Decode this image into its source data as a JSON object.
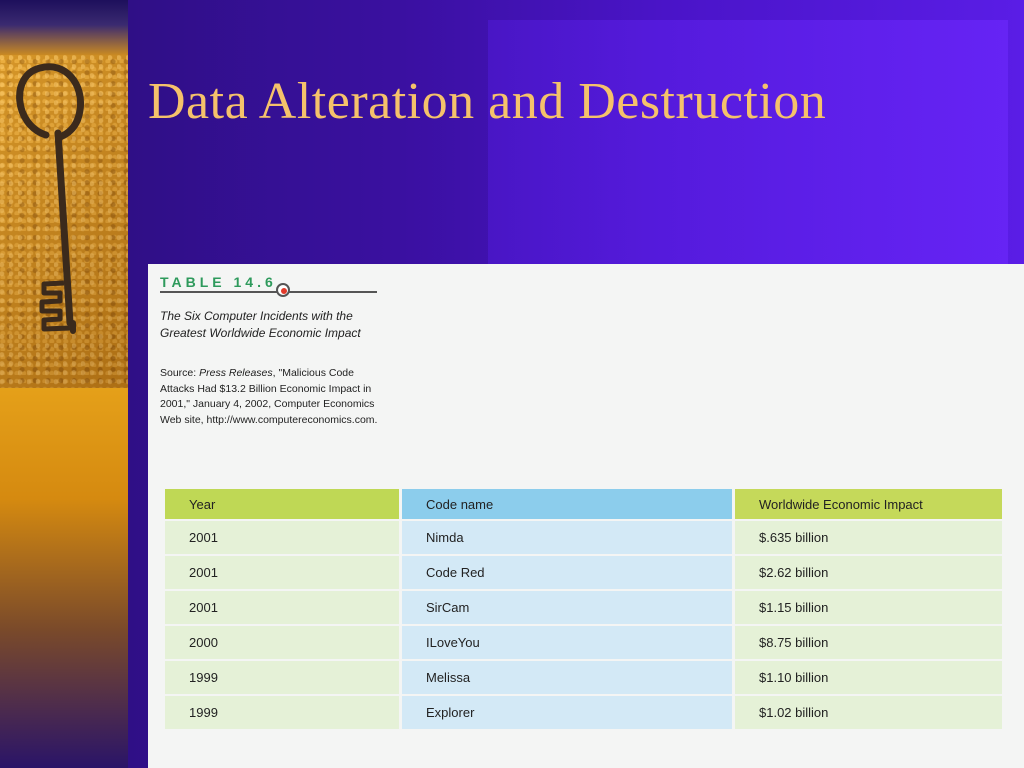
{
  "slide": {
    "title": "Data Alteration and Destruction"
  },
  "document": {
    "table_label": "TABLE 14.6",
    "caption": "The Six Computer Incidents with the Greatest Worldwide Economic Impact",
    "source_prefix": "Source: ",
    "source_publication": "Press Releases",
    "source_rest": ", \"Malicious Code Attacks Had $13.2 Billion Economic Impact in 2001,\" January 4, 2002, Computer Economics Web site, http://www.computereconomics.com.",
    "table": {
      "columns": [
        "Year",
        "Code name",
        "Worldwide Economic Impact"
      ],
      "rows": [
        [
          "2001",
          "Nimda",
          "$.635 billion"
        ],
        [
          "2001",
          "Code Red",
          "$2.62 billion"
        ],
        [
          "2001",
          "SirCam",
          "$1.15 billion"
        ],
        [
          "2000",
          "ILoveYou",
          "$8.75 billion"
        ],
        [
          "1999",
          "Melissa",
          "$1.10 billion"
        ],
        [
          "1999",
          "Explorer",
          "$1.02 billion"
        ]
      ]
    }
  },
  "colors": {
    "title": "#f5c26b",
    "label_green": "#2e9a5c",
    "header_year": "#bfd855",
    "header_codename": "#8ccdec",
    "header_impact": "#c5d95a",
    "cell_green": "#e5f1d7",
    "cell_blue": "#d3e9f6"
  }
}
